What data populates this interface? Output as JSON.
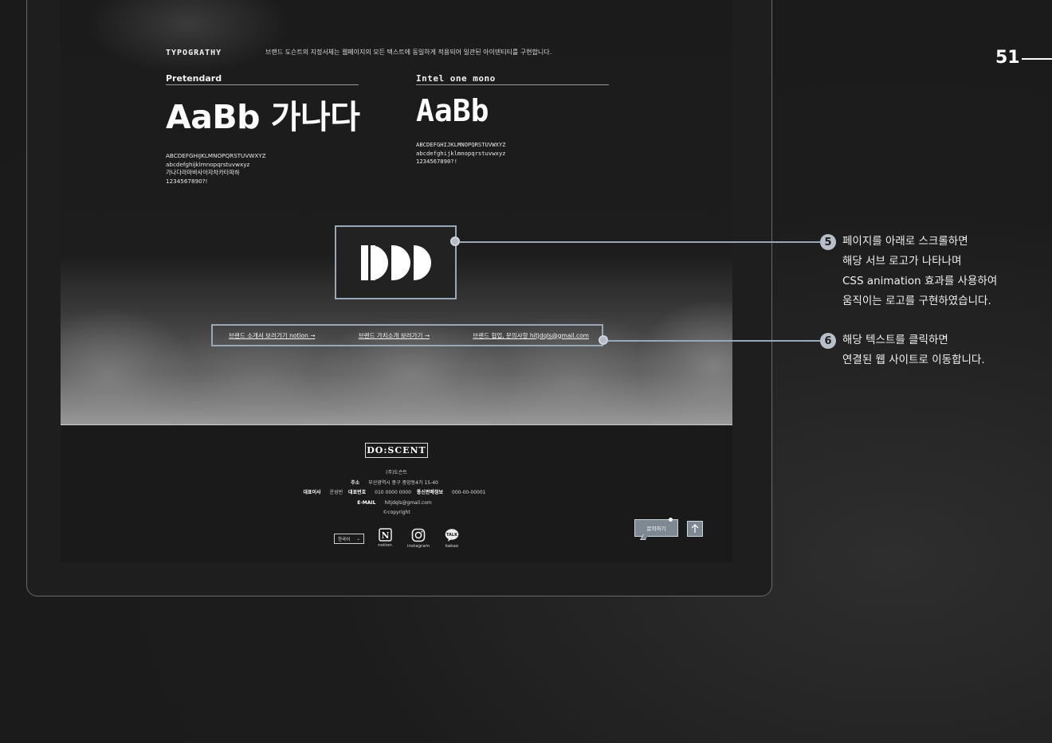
{
  "page": {
    "number": "51"
  },
  "typography": {
    "title": "TYPOGRATHY",
    "description": "브랜드 도슨트의 지정서체는 웹페이지의 모든 텍스트에 동일하게 적용되어 일관된 아이덴티티를 구현합니다.",
    "fonts": [
      {
        "name": "Pretendard",
        "sample": "AaBb 가나다",
        "glyphs": [
          "ABCDEFGHIJKLMNOPQRSTUVWXYZ",
          "abcdefghijklmnopqrstuvwxyz",
          "가나다라마바사아자차카타파하",
          "1234567890?!"
        ]
      },
      {
        "name": "Intel one mono",
        "sample": "AaBb",
        "glyphs": [
          "ABCDEFGHIJKLMNOPQRSTUVWXYZ",
          "abcdefghijklmnopqrstuvwxyz",
          "1234567890?!"
        ]
      }
    ]
  },
  "links": [
    "브랜드 소개서 보러가기 notion →",
    "브랜드 가치소개 보러가기 →",
    "브랜드 협업, 문의사항 hitjdqls@gmail.com"
  ],
  "footer": {
    "logo": "DO:SCENT",
    "company": "(주)도슨트",
    "address_label": "주소",
    "address": "부산광역시 중구 중앙동4가 15-40",
    "ceo_label": "대표이사",
    "ceo": "운성빈",
    "phone_label": "대표번호",
    "phone": "010 0000 0000",
    "telecom_label": "통신판매정보",
    "telecom": "000-00-00001",
    "email_label": "E-MAIL",
    "email": "hitjdqls@gmail.com",
    "copyright": "©copyright",
    "language": "한국어",
    "sns": [
      {
        "label": "notion",
        "icon": "notion-icon"
      },
      {
        "label": "instagram",
        "icon": "instagram-icon"
      },
      {
        "label": "kakao",
        "icon": "kakao-talk-icon"
      }
    ],
    "inquiry_button": "문의하기",
    "top_button_icon": "arrow-up-icon"
  },
  "callouts": [
    {
      "number": "5",
      "lines": [
        "페이지를 아래로 스크롤하면",
        "해당 서브 로고가 나타나며",
        "CSS animation 효과를 사용하여",
        "움직이는 로고를 구현하였습니다."
      ]
    },
    {
      "number": "6",
      "lines": [
        "해당 텍스트를 클릭하면",
        "연결된 웹 사이트로 이동합니다."
      ]
    }
  ],
  "colors": {
    "accent": "#9aa7b5",
    "background": "#1c1c1c",
    "button": "#7d8893"
  }
}
